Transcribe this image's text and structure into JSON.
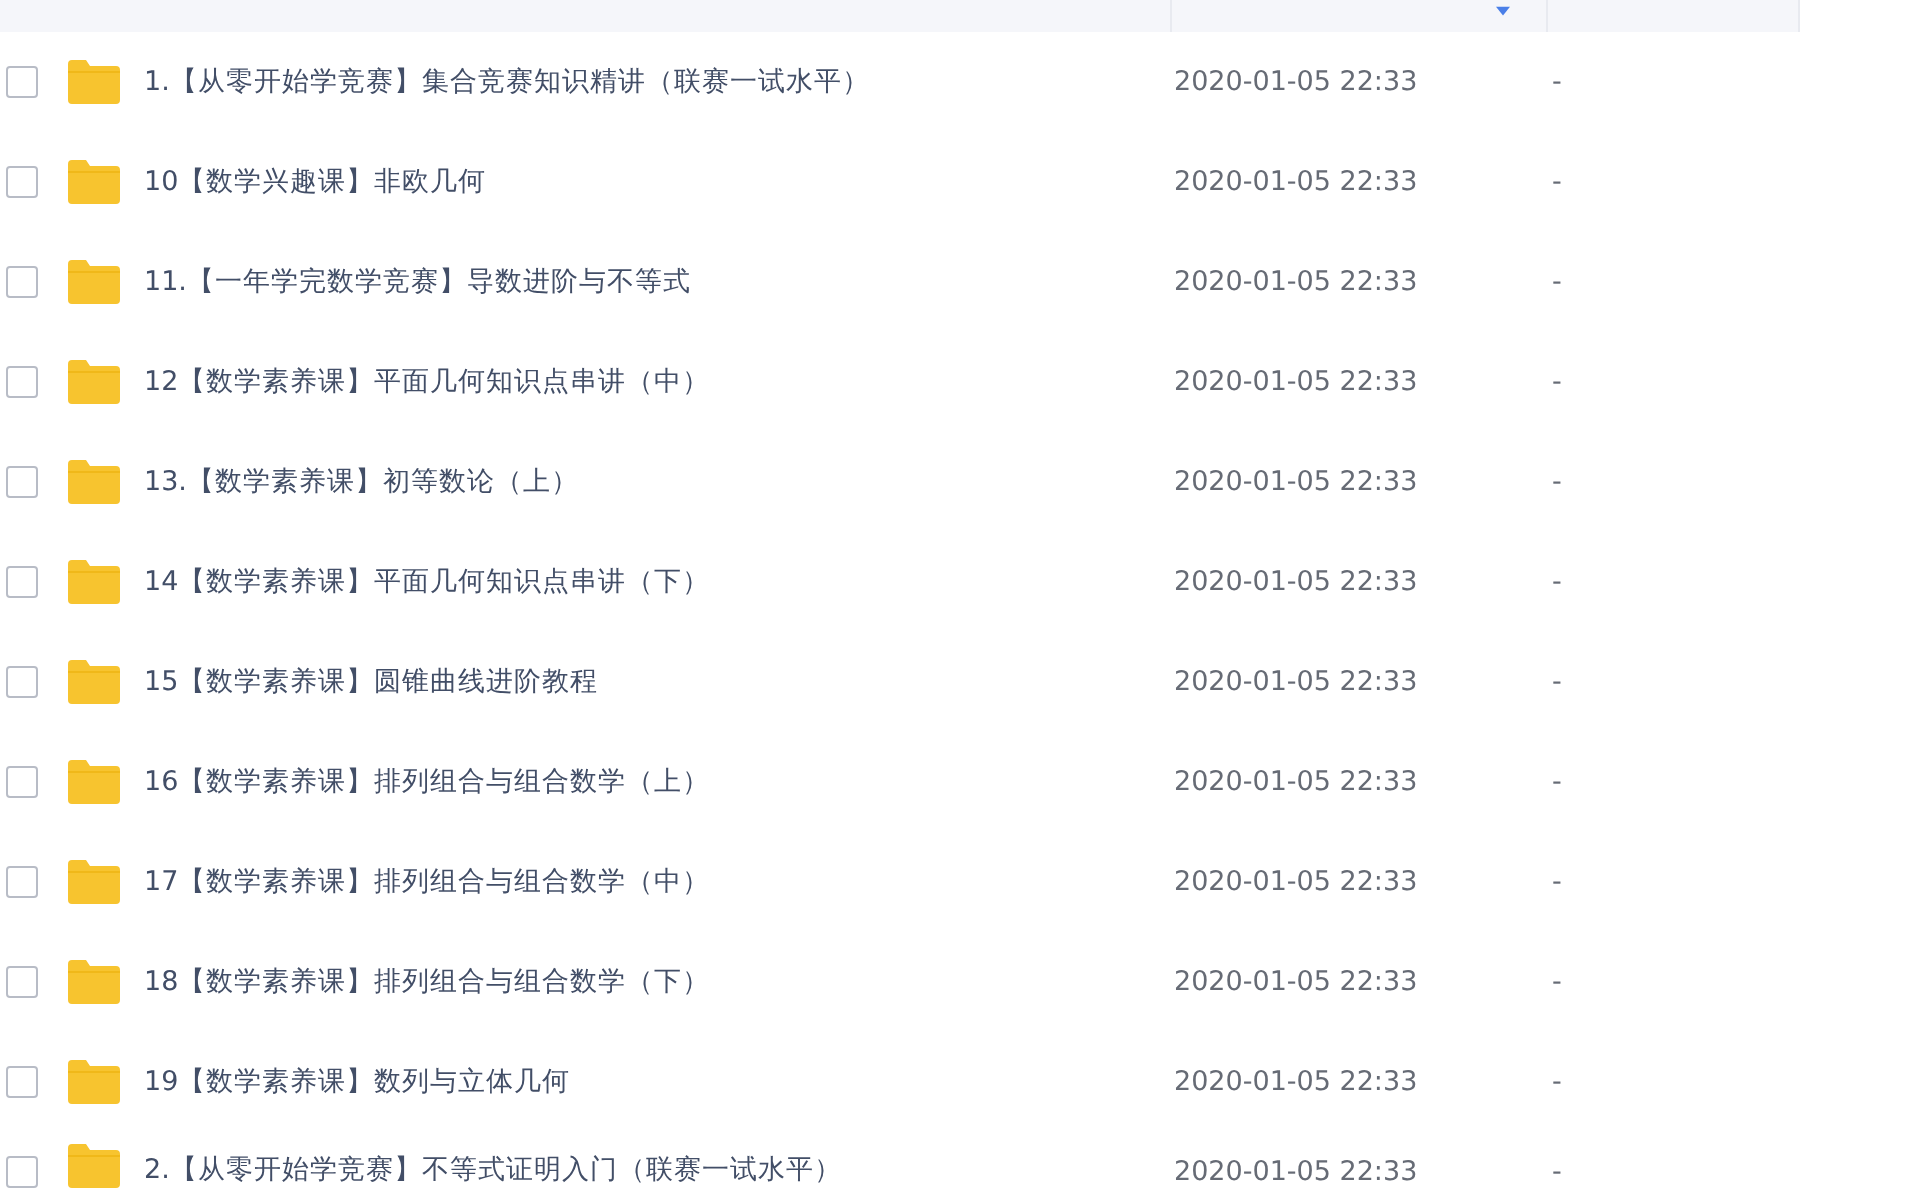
{
  "rows": [
    {
      "name": "1.【从零开始学竞赛】集合竞赛知识精讲（联赛一试水平）",
      "modified": "2020-01-05 22:33",
      "size": "-",
      "checked": false
    },
    {
      "name": "10【数学兴趣课】非欧几何",
      "modified": "2020-01-05 22:33",
      "size": "-",
      "checked": false
    },
    {
      "name": "11.【一年学完数学竞赛】导数进阶与不等式",
      "modified": "2020-01-05 22:33",
      "size": "-",
      "checked": false
    },
    {
      "name": "12【数学素养课】平面几何知识点串讲（中）",
      "modified": "2020-01-05 22:33",
      "size": "-",
      "checked": false
    },
    {
      "name": "13.【数学素养课】初等数论（上）",
      "modified": "2020-01-05 22:33",
      "size": "-",
      "checked": false
    },
    {
      "name": "14【数学素养课】平面几何知识点串讲（下）",
      "modified": "2020-01-05 22:33",
      "size": "-",
      "checked": false
    },
    {
      "name": "15【数学素养课】圆锥曲线进阶教程",
      "modified": "2020-01-05 22:33",
      "size": "-",
      "checked": false
    },
    {
      "name": "16【数学素养课】排列组合与组合数学（上）",
      "modified": "2020-01-05 22:33",
      "size": "-",
      "checked": false
    },
    {
      "name": "17【数学素养课】排列组合与组合数学（中）",
      "modified": "2020-01-05 22:33",
      "size": "-",
      "checked": false
    },
    {
      "name": "18【数学素养课】排列组合与组合数学（下）",
      "modified": "2020-01-05 22:33",
      "size": "-",
      "checked": false
    },
    {
      "name": "19【数学素养课】数列与立体几何",
      "modified": "2020-01-05 22:33",
      "size": "-",
      "checked": false
    },
    {
      "name": "2.【从零开始学竞赛】不等式证明入门（联赛一试水平）",
      "modified": "2020-01-05 22:33",
      "size": "-",
      "checked": false
    }
  ]
}
